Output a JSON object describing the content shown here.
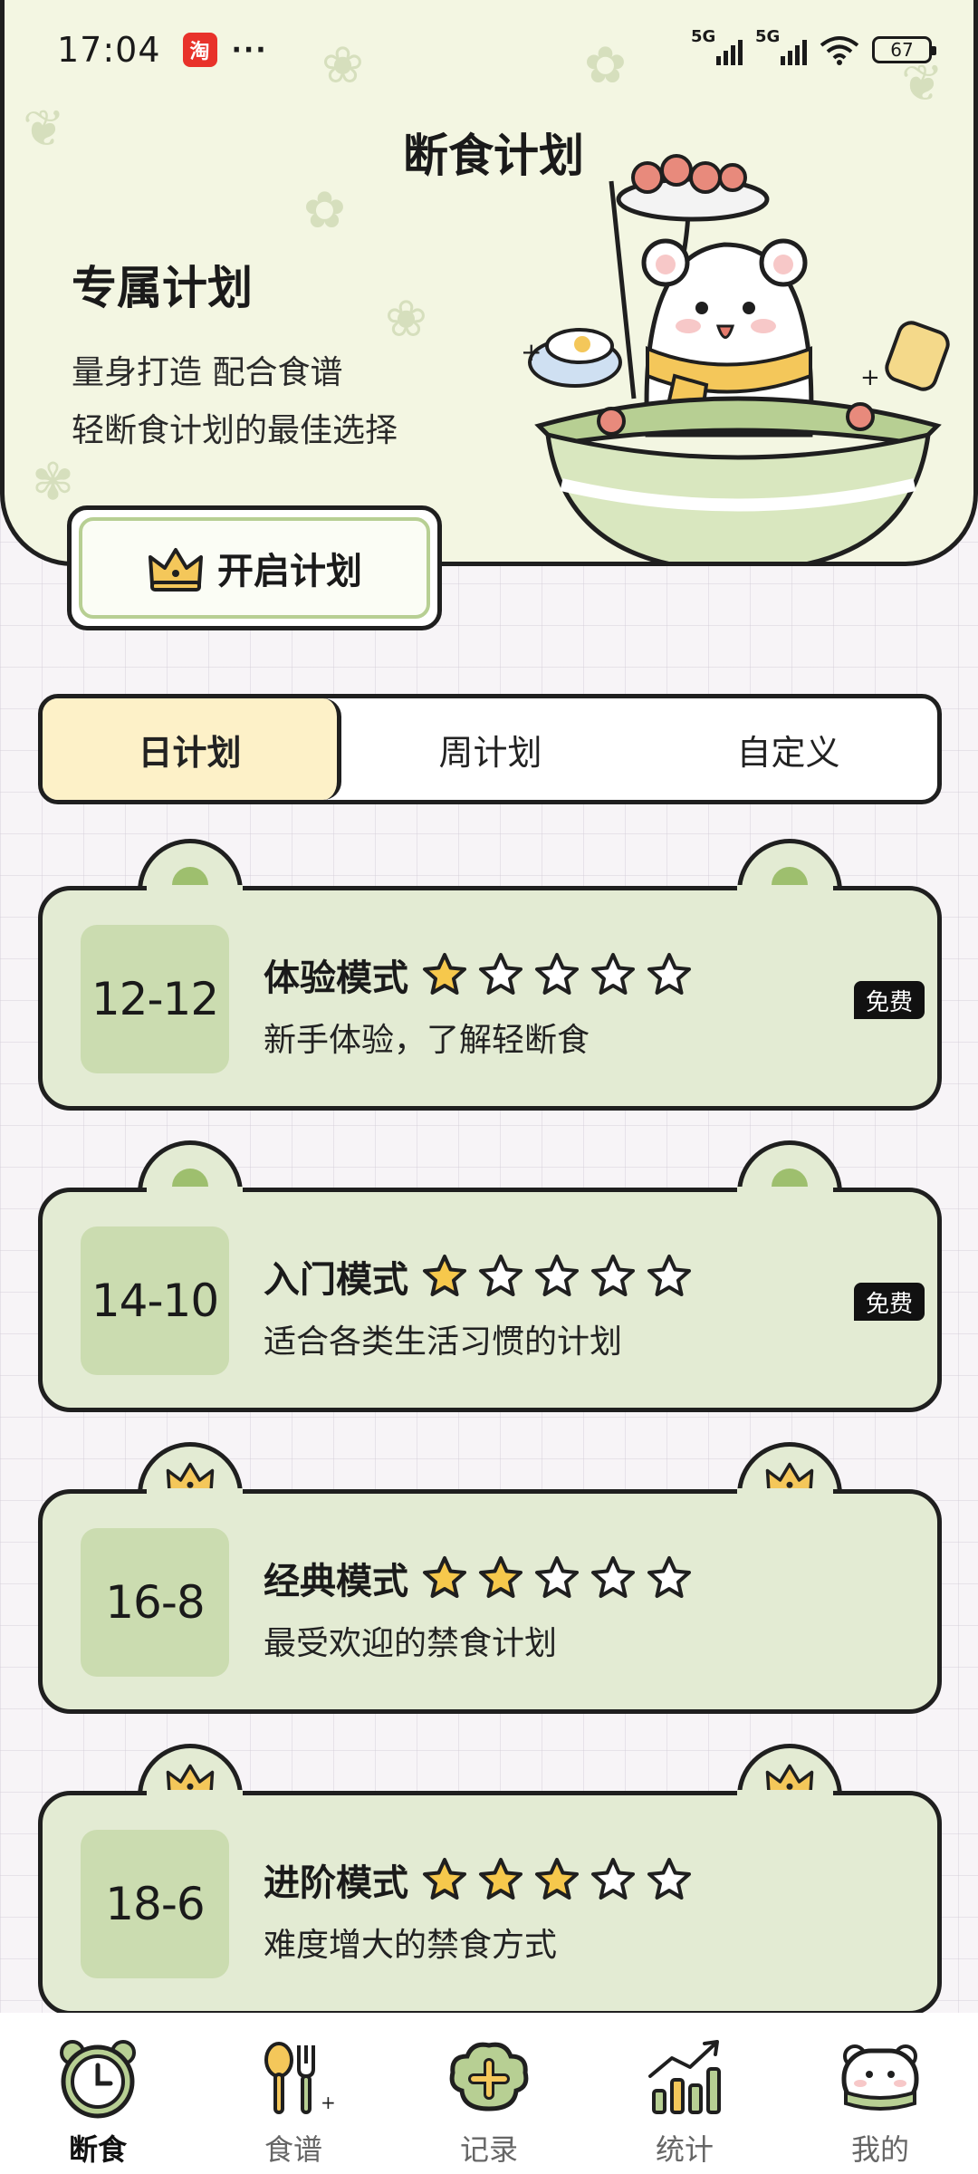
{
  "status_bar": {
    "time": "17:04",
    "app_badge": "淘",
    "more": "···",
    "network1": "5G",
    "network2": "5G",
    "battery": "67"
  },
  "header": {
    "title": "断食计划",
    "heading": "专属计划",
    "desc_line1": "量身打造 配合食谱",
    "desc_line2": "轻断食计划的最佳选择",
    "start_button": "开启计划"
  },
  "tabs": [
    {
      "label": "日计划",
      "active": true
    },
    {
      "label": "周计划",
      "active": false
    },
    {
      "label": "自定义",
      "active": false
    }
  ],
  "plans": [
    {
      "ratio": "12-12",
      "name": "体验模式",
      "desc": "新手体验，了解轻断食",
      "stars_filled": 1,
      "stars_total": 5,
      "badge": "免费",
      "tab_icon": "dot"
    },
    {
      "ratio": "14-10",
      "name": "入门模式",
      "desc": "适合各类生活习惯的计划",
      "stars_filled": 1,
      "stars_total": 5,
      "badge": "免费",
      "tab_icon": "dot"
    },
    {
      "ratio": "16-8",
      "name": "经典模式",
      "desc": "最受欢迎的禁食计划",
      "stars_filled": 2,
      "stars_total": 5,
      "badge": "",
      "tab_icon": "crown-icon"
    },
    {
      "ratio": "18-6",
      "name": "进阶模式",
      "desc": "难度增大的禁食方式",
      "stars_filled": 3,
      "stars_total": 5,
      "badge": "",
      "tab_icon": "crown-icon"
    }
  ],
  "bottom_nav": [
    {
      "label": "断食",
      "icon": "clock-icon",
      "active": true
    },
    {
      "label": "食谱",
      "icon": "utensils-icon",
      "active": false
    },
    {
      "label": "记录",
      "icon": "add-record-icon",
      "active": false
    },
    {
      "label": "统计",
      "icon": "chart-icon",
      "active": false
    },
    {
      "label": "我的",
      "icon": "bear-avatar-icon",
      "active": false
    }
  ],
  "colors": {
    "header_bg": "#f3f6e2",
    "card_bg": "#e3ebd3",
    "ratio_bg": "#cbdcb0",
    "accent_green": "#9ebf6e",
    "active_tab": "#fdf1c8",
    "star_filled": "#f6c84c"
  }
}
